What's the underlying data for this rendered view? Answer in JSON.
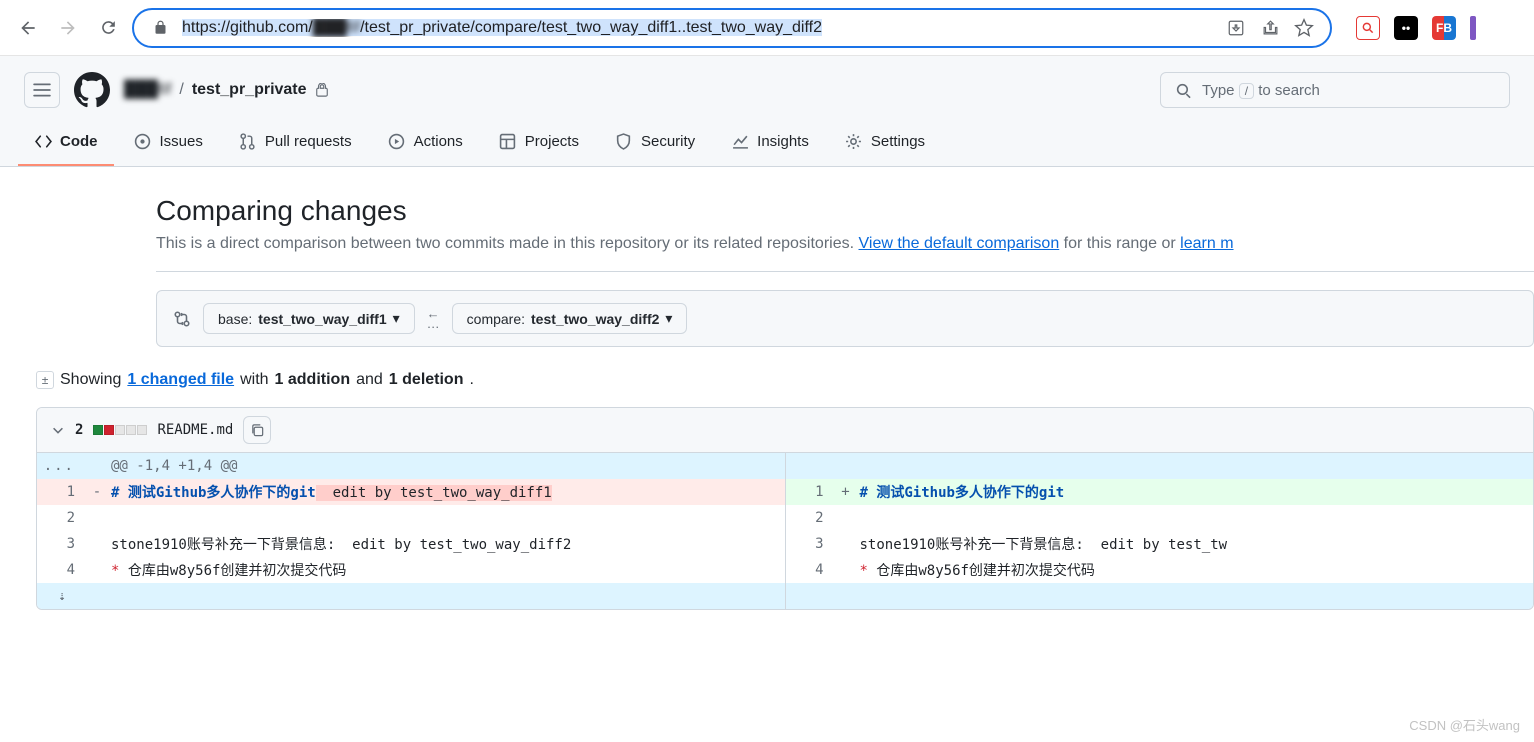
{
  "browser": {
    "url_prefix": "https://github.com/",
    "url_owner_blur": "███6f",
    "url_rest": "/test_pr_private/compare/test_two_way_diff1..test_two_way_diff2"
  },
  "breadcrumb": {
    "owner_blur": "███6f",
    "separator": "/",
    "repo": "test_pr_private"
  },
  "search": {
    "placeholder_pre": "Type ",
    "kbd": "/",
    "placeholder_post": " to search"
  },
  "tabs": {
    "code": "Code",
    "issues": "Issues",
    "pulls": "Pull requests",
    "actions": "Actions",
    "projects": "Projects",
    "security": "Security",
    "insights": "Insights",
    "settings": "Settings"
  },
  "compare": {
    "title": "Comparing changes",
    "desc_pre": "This is a direct comparison between two commits made in this repository or its related repositories. ",
    "link1": "View the default comparison",
    "desc_mid": " for this range or ",
    "link2": "learn m",
    "base_label": "base: ",
    "base_branch": "test_two_way_diff1",
    "compare_label": "compare: ",
    "compare_branch": "test_two_way_diff2"
  },
  "stats": {
    "showing": "Showing ",
    "changed": "1 changed file",
    "with": " with ",
    "add": "1 addition",
    "and": " and ",
    "del": "1 deletion",
    "period": "."
  },
  "file": {
    "num": "2",
    "name": "README.md",
    "hunk": "@@ -1,4 +1,4 @@",
    "left": {
      "l1": "# 测试Github多人协作下的git",
      "l1_hl": "  edit by test_two_way_diff1",
      "l2_num": "2",
      "l3_num": "3",
      "l3": "stone1910账号补充一下背景信息:  edit by test_two_way_diff2",
      "l4_num": "4",
      "l4_pre": "* ",
      "l4": "仓库由w8y56f创建并初次提交代码"
    },
    "right": {
      "l1": "# 测试Github多人协作下的git",
      "l1_num": "1",
      "l2_num": "2",
      "l3_num": "3",
      "l3": "stone1910账号补充一下背景信息:  edit by test_tw",
      "l4_num": "4",
      "l4_pre": "* ",
      "l4": "仓库由w8y56f创建并初次提交代码"
    }
  },
  "watermark": "CSDN @石头wang"
}
